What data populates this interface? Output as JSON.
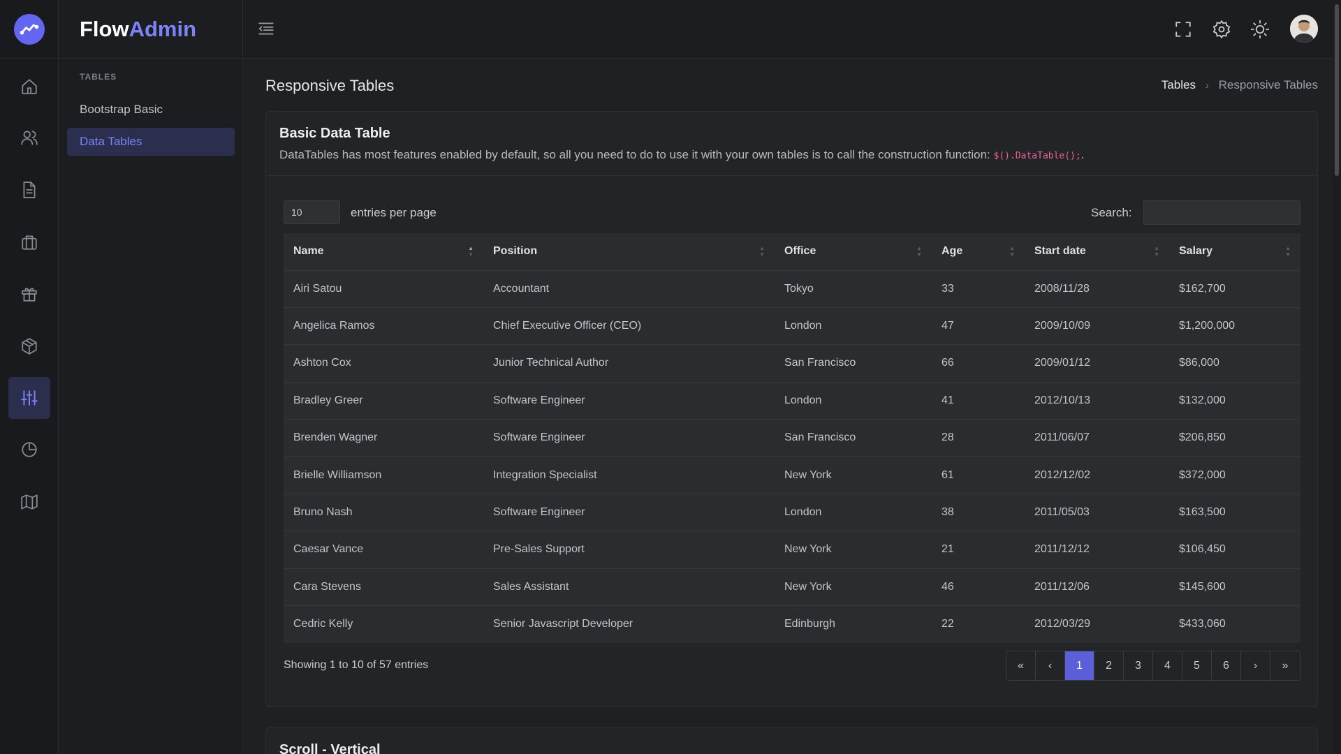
{
  "brand": {
    "name_part1": "Flow",
    "name_part2": "Admin"
  },
  "rail": {
    "icons": [
      "home-icon",
      "users-icon",
      "document-icon",
      "briefcase-icon",
      "gift-icon",
      "package-icon",
      "sliders-icon",
      "pie-chart-icon",
      "map-icon"
    ],
    "active": "sliders-icon"
  },
  "sidebar": {
    "heading": "TABLES",
    "items": [
      {
        "label": "Bootstrap Basic",
        "active": false
      },
      {
        "label": "Data Tables",
        "active": true
      }
    ]
  },
  "topbar": {
    "icons": [
      "menu-toggle-icon",
      "fullscreen-icon",
      "settings-icon",
      "theme-toggle-icon",
      "user-avatar"
    ]
  },
  "page": {
    "title": "Responsive Tables",
    "breadcrumb": {
      "parent": "Tables",
      "separator": "›",
      "current": "Responsive Tables"
    }
  },
  "card": {
    "title": "Basic Data Table",
    "description": "DataTables has most features enabled by default, so all you need to do to use it with your own tables is to call the construction function:",
    "code": "$().DataTable();",
    "description_end": "."
  },
  "controls": {
    "entries_value": "10",
    "entries_label": "entries per page",
    "search_label": "Search:",
    "search_value": ""
  },
  "table": {
    "columns": [
      "Name",
      "Position",
      "Office",
      "Age",
      "Start date",
      "Salary"
    ],
    "sort_column": "Name",
    "sort_direction": "asc",
    "rows": [
      [
        "Airi Satou",
        "Accountant",
        "Tokyo",
        "33",
        "2008/11/28",
        "$162,700"
      ],
      [
        "Angelica Ramos",
        "Chief Executive Officer (CEO)",
        "London",
        "47",
        "2009/10/09",
        "$1,200,000"
      ],
      [
        "Ashton Cox",
        "Junior Technical Author",
        "San Francisco",
        "66",
        "2009/01/12",
        "$86,000"
      ],
      [
        "Bradley Greer",
        "Software Engineer",
        "London",
        "41",
        "2012/10/13",
        "$132,000"
      ],
      [
        "Brenden Wagner",
        "Software Engineer",
        "San Francisco",
        "28",
        "2011/06/07",
        "$206,850"
      ],
      [
        "Brielle Williamson",
        "Integration Specialist",
        "New York",
        "61",
        "2012/12/02",
        "$372,000"
      ],
      [
        "Bruno Nash",
        "Software Engineer",
        "London",
        "38",
        "2011/05/03",
        "$163,500"
      ],
      [
        "Caesar Vance",
        "Pre-Sales Support",
        "New York",
        "21",
        "2011/12/12",
        "$106,450"
      ],
      [
        "Cara Stevens",
        "Sales Assistant",
        "New York",
        "46",
        "2011/12/06",
        "$145,600"
      ],
      [
        "Cedric Kelly",
        "Senior Javascript Developer",
        "Edinburgh",
        "22",
        "2012/03/29",
        "$433,060"
      ]
    ]
  },
  "footer": {
    "info": "Showing 1 to 10 of 57 entries",
    "pager": [
      "«",
      "‹",
      "1",
      "2",
      "3",
      "4",
      "5",
      "6",
      "›",
      "»"
    ],
    "current_page": "1"
  },
  "card2": {
    "title": "Scroll - Vertical"
  },
  "colors": {
    "accent": "#6366f1",
    "active_bg": "#2b2e4d",
    "code": "#f06292"
  }
}
